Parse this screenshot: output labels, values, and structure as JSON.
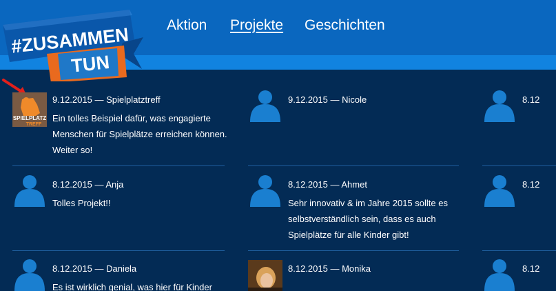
{
  "logo": {
    "line1": "#ZUSAMMEN",
    "line2": "TUN"
  },
  "nav": {
    "items": [
      {
        "label": "Aktion"
      },
      {
        "label": "Projekte"
      },
      {
        "label": "Geschichten"
      }
    ]
  },
  "comments": [
    {
      "date": "9.12.2015",
      "author": "Spielplatztreff",
      "text": "Ein tolles Beispiel dafür, was engagierte Menschen für Spielplätze erreichen können. Weiter so!",
      "avatar": "spielplatz-logo",
      "logo_line1": "SPIELPLATZ",
      "logo_line2": "TREFF"
    },
    {
      "date": "9.12.2015",
      "author": "Nicole",
      "text": "",
      "avatar": "default-user"
    },
    {
      "date": "8.12",
      "author": "",
      "text": "",
      "avatar": "default-user"
    },
    {
      "date": "8.12.2015",
      "author": "Anja",
      "text": "Tolles Projekt!!",
      "avatar": "default-user"
    },
    {
      "date": "8.12.2015",
      "author": "Ahmet",
      "text": "Sehr innovativ & im Jahre 2015 sollte es selbstverständlich sein, dass es auch Spielplätze für alle Kinder gibt!",
      "avatar": "default-user"
    },
    {
      "date": "8.12",
      "author": "",
      "text": "",
      "avatar": "default-user"
    },
    {
      "date": "8.12.2015",
      "author": "Daniela",
      "text": "Es ist wirklich genial, was hier für Kinder",
      "avatar": "default-user"
    },
    {
      "date": "8.12.2015",
      "author": "Monika",
      "text": "",
      "avatar": "photo"
    },
    {
      "date": "8.12",
      "author": "",
      "text": "",
      "avatar": "default-user"
    }
  ],
  "separator": " — ",
  "colors": {
    "background": "#032b55",
    "header": "#0a67bf",
    "stripe": "#1183e0",
    "avatar": "#1a7fd0"
  }
}
